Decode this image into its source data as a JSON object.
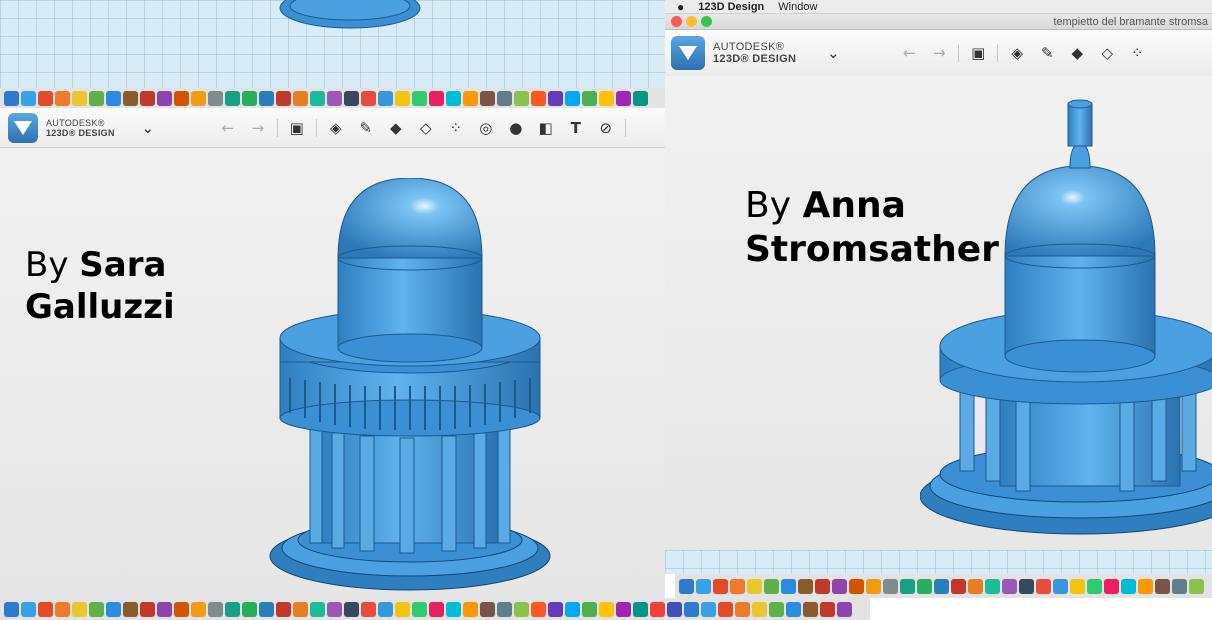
{
  "left_window": {
    "brand_line1": "AUTODESK®",
    "brand_line2": "123D® DESIGN",
    "caption_prefix": "By",
    "caption_first": "Sara",
    "caption_last": "Galluzzi"
  },
  "right_window": {
    "menu_app": "123D Design",
    "menu_window": "Window",
    "window_title": "tempietto del bramante stromsa",
    "brand_line1": "AUTODESK®",
    "brand_line2": "123D® DESIGN",
    "caption_prefix": "By",
    "caption_first": "Anna",
    "caption_last": "Stromsather"
  },
  "icons": {
    "undo": "undo-icon",
    "redo": "redo-icon",
    "chevron": "chevron-down-icon",
    "model_color": "#3b8fd4"
  },
  "dock_colors": [
    "#2e7ad1",
    "#3aa0e8",
    "#e24b2a",
    "#ee7a2b",
    "#e8c72f",
    "#5fb04a",
    "#2a8be0",
    "#8a5c2c",
    "#c0392b",
    "#8e44ad",
    "#d35400",
    "#f39c12",
    "#7f8c8d",
    "#16a085",
    "#27ae60",
    "#2980b9",
    "#c0392b",
    "#e67e22",
    "#1abc9c",
    "#9b59b6",
    "#34495e",
    "#e74c3c",
    "#3498db",
    "#f1c40f",
    "#2ecc71",
    "#e91e63",
    "#00bcd4",
    "#ff9800",
    "#795548",
    "#607d8b",
    "#8bc34a",
    "#ff5722",
    "#673ab7",
    "#03a9f4",
    "#4caf50",
    "#ffc107",
    "#9c27b0",
    "#009688",
    "#f44336",
    "#3f51b5"
  ]
}
